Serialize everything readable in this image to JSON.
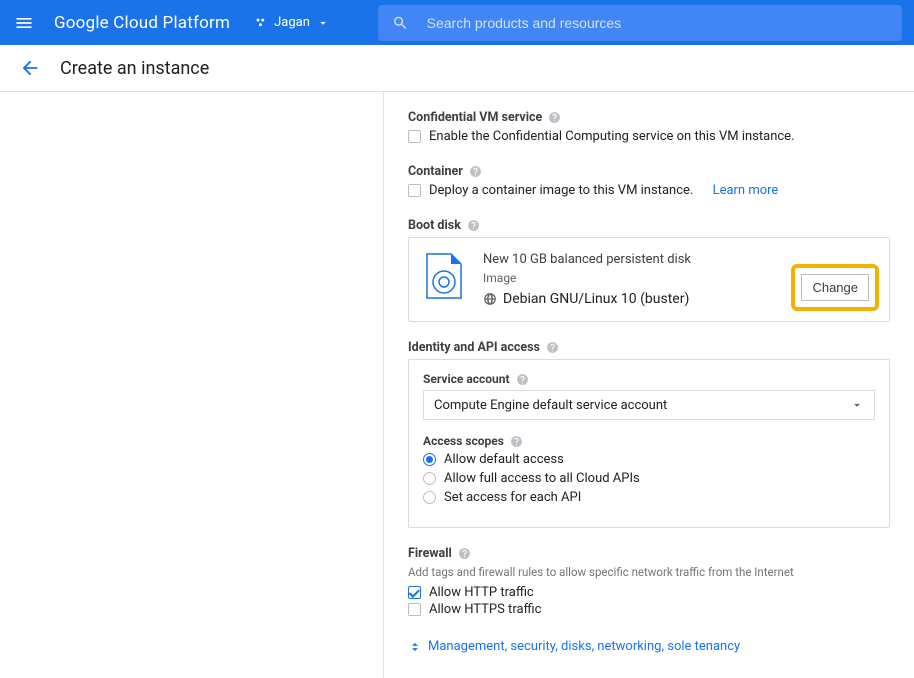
{
  "header": {
    "logo": "Google Cloud Platform",
    "project": "Jagan",
    "search_placeholder": "Search products and resources"
  },
  "subheader": {
    "title": "Create an instance"
  },
  "confidential": {
    "label": "Confidential VM service",
    "checkbox": "Enable the Confidential Computing service on this VM instance."
  },
  "container": {
    "label": "Container",
    "checkbox": "Deploy a container image to this VM instance.",
    "learn_more": "Learn more"
  },
  "bootdisk": {
    "label": "Boot disk",
    "title": "New 10 GB balanced persistent disk",
    "image_label": "Image",
    "os": "Debian GNU/Linux 10 (buster)",
    "change": "Change"
  },
  "identity": {
    "label": "Identity and API access",
    "service_account_label": "Service account",
    "service_account_value": "Compute Engine default service account",
    "access_scopes_label": "Access scopes",
    "scopes": [
      "Allow default access",
      "Allow full access to all Cloud APIs",
      "Set access for each API"
    ]
  },
  "firewall": {
    "label": "Firewall",
    "helper": "Add tags and firewall rules to allow specific network traffic from the Internet",
    "http": "Allow HTTP traffic",
    "https": "Allow HTTPS traffic"
  },
  "expand": "Management, security, disks, networking, sole tenancy"
}
